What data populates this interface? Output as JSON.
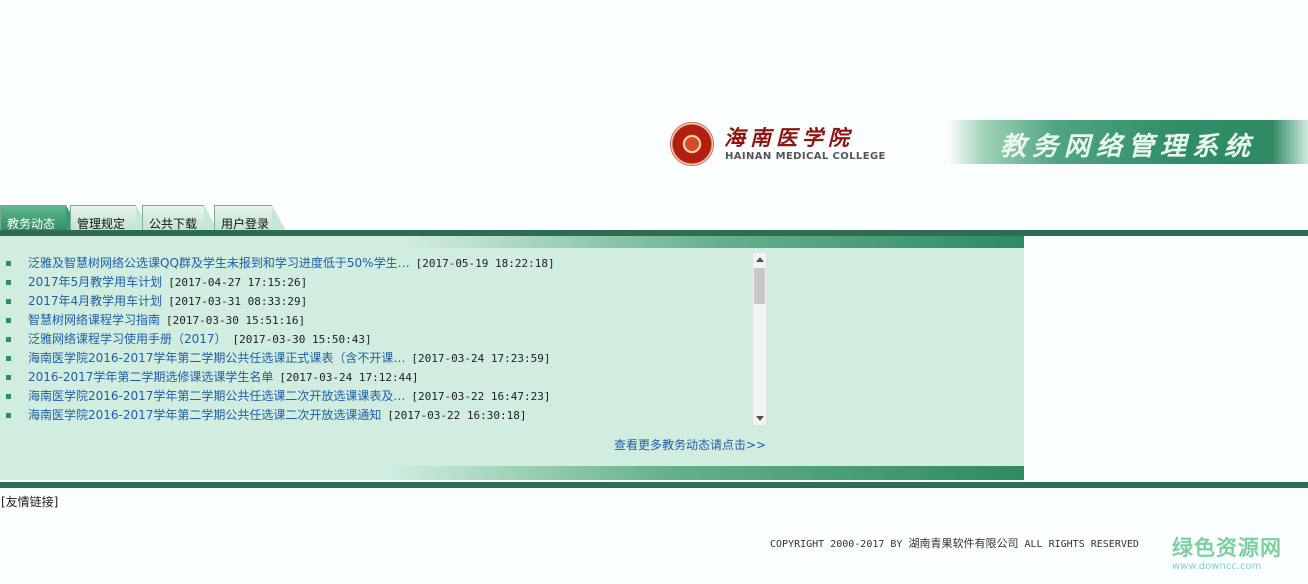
{
  "header": {
    "college_cn": "海南医学院",
    "college_en": "HAINAN MEDICAL COLLEGE",
    "system_title": "教务网络管理系统"
  },
  "tabs": [
    {
      "label": "教务动态",
      "active": true
    },
    {
      "label": "管理规定",
      "active": false
    },
    {
      "label": "公共下载",
      "active": false
    },
    {
      "label": "用户登录",
      "active": false
    }
  ],
  "news": [
    {
      "title": "泛雅及智慧树网络公选课QQ群及学生未报到和学习进度低于50%学生…",
      "date": "[2017-05-19 18:22:18]"
    },
    {
      "title": "2017年5月教学用车计划",
      "date": "[2017-04-27 17:15:26]"
    },
    {
      "title": "2017年4月教学用车计划",
      "date": "[2017-03-31 08:33:29]"
    },
    {
      "title": "智慧树网络课程学习指南",
      "date": "[2017-03-30 15:51:16]"
    },
    {
      "title": "泛雅网络课程学习使用手册（2017）",
      "date": "[2017-03-30 15:50:43]"
    },
    {
      "title": "海南医学院2016-2017学年第二学期公共任选课正式课表（含不开课…",
      "date": "[2017-03-24 17:23:59]"
    },
    {
      "title": "2016-2017学年第二学期选修课选课学生名单",
      "date": "[2017-03-24 17:12:44]"
    },
    {
      "title": "海南医学院2016-2017学年第二学期公共任选课二次开放选课课表及…",
      "date": "[2017-03-22 16:47:23]"
    },
    {
      "title": "海南医学院2016-2017学年第二学期公共任选课二次开放选课通知",
      "date": "[2017-03-22 16:30:18]"
    }
  ],
  "more_link": "查看更多教务动态请点击>>",
  "friend_links": "[友情链接]",
  "footer": {
    "copyright_prefix": "COPYRIGHT 2000-2017 BY",
    "company": "湖南青果软件有限公司",
    "copyright_suffix": "ALL RIGHTS RESERVED"
  },
  "watermark": {
    "cn": "绿色资源网",
    "url": "www.downcc.com"
  }
}
